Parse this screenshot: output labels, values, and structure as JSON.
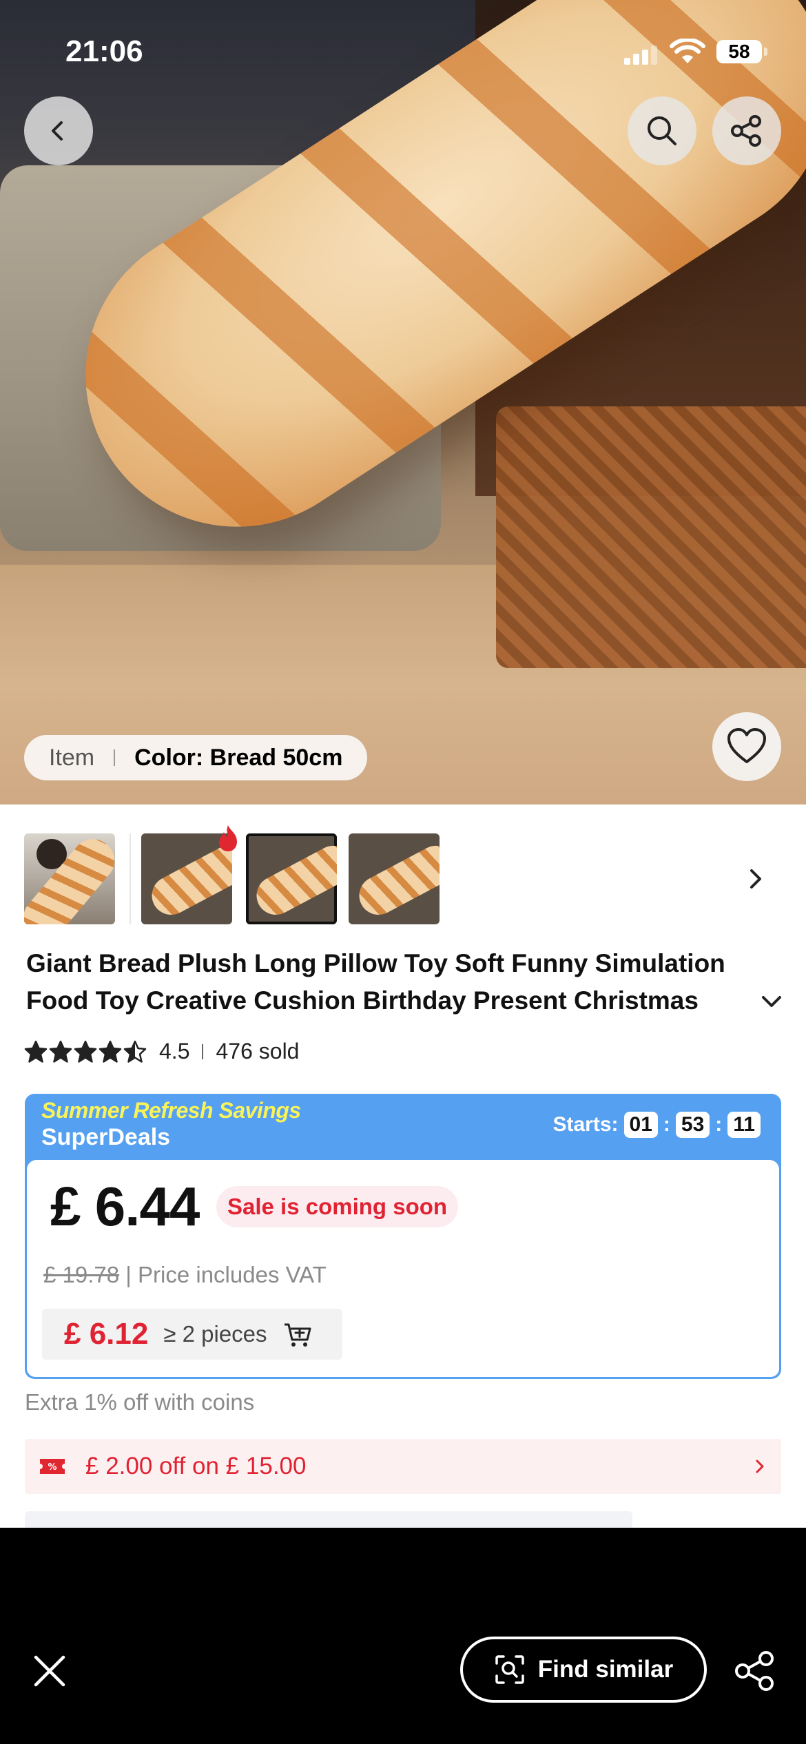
{
  "status_bar": {
    "time": "21:06",
    "battery": "58"
  },
  "hero": {
    "variant_item_label": "Item",
    "variant_color_label": "Color: Bread 50cm"
  },
  "icons": {
    "back": "chevron-left-icon",
    "search": "search-icon",
    "share": "share-icon",
    "favorite": "heart-icon",
    "hot": "flame-icon",
    "thumbs_next": "chevron-right-icon",
    "expand": "chevron-down-icon",
    "star": "star-icon",
    "cart": "add-to-cart-icon",
    "coupon": "coupon-icon",
    "close": "close-icon",
    "find_similar": "image-search-icon"
  },
  "product": {
    "title": "Giant Bread Plush Long Pillow Toy Soft Funny Simulation Food Toy Creative Cushion Birthday Present Christmas",
    "rating_value": "4.5",
    "rating_stars": 4.5,
    "sold": "476 sold"
  },
  "deal": {
    "headline_1": "Summer Refresh Savings",
    "headline_2": "SuperDeals",
    "starts_label": "Starts:",
    "countdown": {
      "h": "01",
      "m": "53",
      "s": "11"
    },
    "price": "£ 6.44",
    "badge": "Sale is coming soon",
    "original_price": "£ 19.78",
    "vat_note": "| Price includes VAT",
    "bulk_price": "£ 6.12",
    "bulk_qty": "≥ 2 pieces"
  },
  "extras": {
    "coins": "Extra 1% off with coins",
    "coupon": "£ 2.00 off on  £ 15.00"
  },
  "bottom_bar": {
    "find_similar": "Find similar"
  },
  "colors": {
    "accent_blue": "#55a0f0",
    "sale_red": "#e02333",
    "headline_yellow": "#f8f35a"
  }
}
